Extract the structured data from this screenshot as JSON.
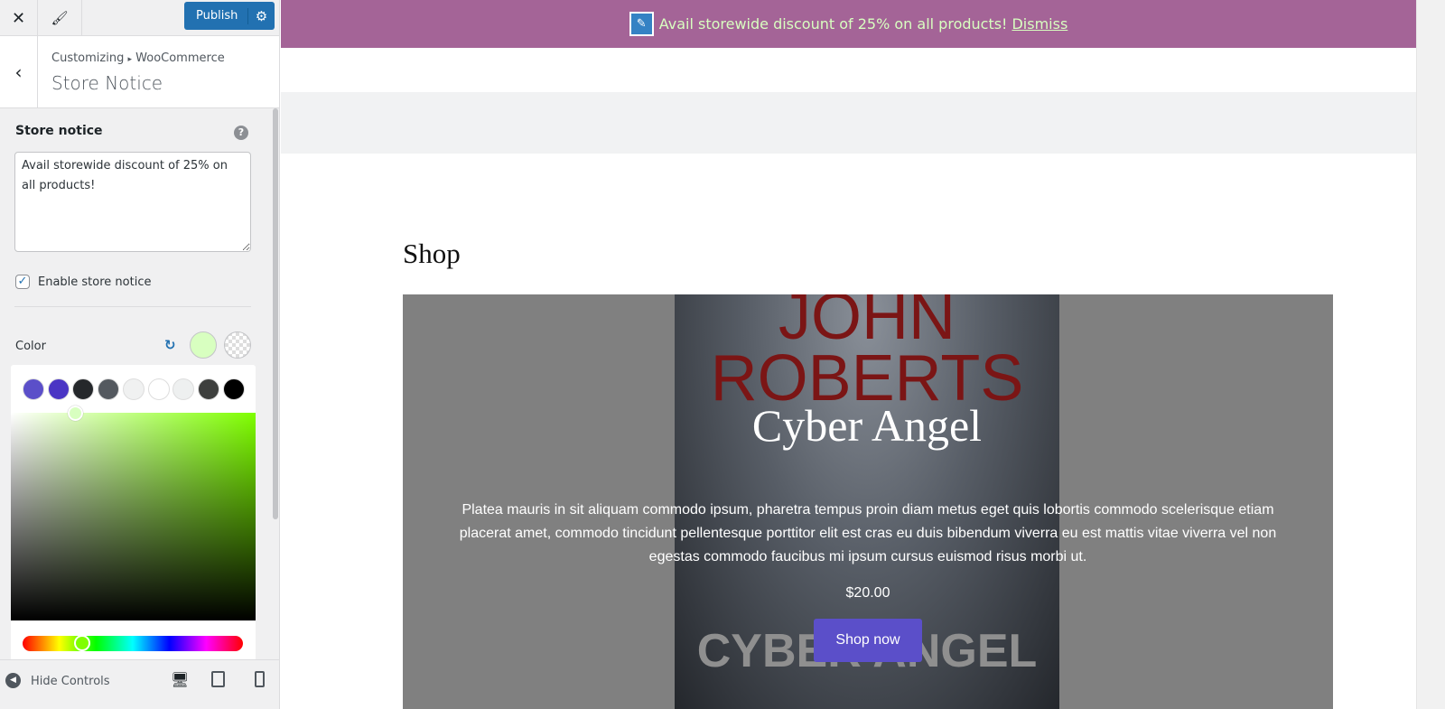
{
  "sidebar": {
    "publish_label": "Publish",
    "breadcrumb": {
      "root": "Customizing",
      "separator": "▸",
      "parent": "WooCommerce"
    },
    "title": "Store Notice",
    "store_notice_label": "Store notice",
    "store_notice_value": "Avail storewide discount of 25% on all products!",
    "enable_label": "Enable store notice",
    "enable_checked": true,
    "color_label": "Color",
    "color_value": "#d8ffc0",
    "palette": [
      "#5b4fc9",
      "#4a35c4",
      "#25282b",
      "#54595f",
      "#f0f1f1",
      "#ffffff",
      "#eef0f0",
      "#3d3f3d",
      "#000000"
    ],
    "hide_controls": "Hide Controls"
  },
  "preview": {
    "notice_text": "Avail storewide discount of 25% on all products!",
    "dismiss": "Dismiss",
    "notice_bg": "#a46497",
    "shop_heading": "Shop",
    "product": {
      "author_line1": "JOHN",
      "author_line2": "ROBERTS",
      "title": "Cyber Angel",
      "cover_subtitle": "CYBER ANGEL",
      "description": "Platea mauris in sit aliquam commodo ipsum, pharetra tempus proin diam metus eget quis lobortis commodo scelerisque etiam placerat amet, commodo tincidunt pellentesque porttitor elit est cras eu duis bibendum viverra eu est mattis vitae viverra vel non egestas commodo faucibus mi ipsum cursus euismod risus morbi ut.",
      "price": "$20.00",
      "button": "Shop now"
    }
  }
}
